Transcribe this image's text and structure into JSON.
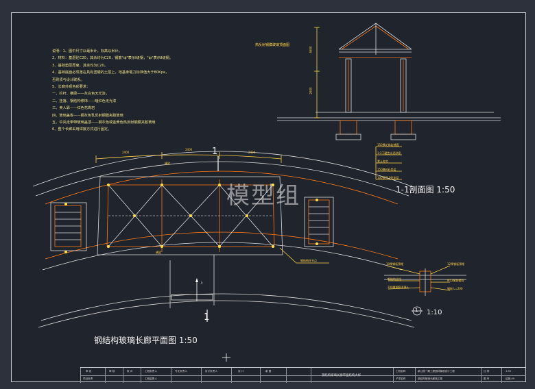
{
  "notes": {
    "lines": [
      "说明：1、图中尺寸以毫米计，标高以米计。",
      "2、材料：基层砼C20，其余均为C20，钢筋\"ф\"表示Ⅰ级钢，\"ф\"表示Ⅱ级钢。",
      "3、基础垫层厚度，其余均为C20。",
      "4、基础底面必须落在具有坚硬的土层上，地基承载力标准值大于80Kpa，",
      "   否则须与设计联系。",
      "5、长廊外观色彩要求：",
      "   一、栏杆、横梁——灰白色无光漆，",
      "   二、挂落、钢结构修饰——暗红色无光漆",
      "   三、美人靠——红色花岗岩",
      "   四、玻璃盖板——钢灰色乳反射钢膜夹胶玻璃",
      "   五、中央走带带玻璃盖顶——钢灰色或金黄色热反射钢膜夹胶玻璃",
      "6、整个长廊采用焊接方式进行固定。"
    ]
  },
  "plan": {
    "title": "钢结构玻璃长廊平面图   1:50",
    "section_mark_top": "1",
    "section_mark_bottom": "1",
    "arrow_label": "上",
    "label_top": "横梁",
    "label_bottom": "横梁",
    "label_right": "钢结构柱节点",
    "dim_1": "2400",
    "dim_2": "2400",
    "dim_3": "2400"
  },
  "section": {
    "header": "热反射钢膜玻璃顶面图",
    "title": "1-1剖面图   1:50",
    "dim_height": "4600",
    "dim_low": "2600",
    "legend": [
      "150厚花岗岩铺面",
      "1:3干硬性水泥砂浆",
      "素土夯实",
      "150厚碎石垫层",
      "100厚C10砼垫层"
    ]
  },
  "detail": {
    "title": "1:10",
    "circle_num": "1",
    "labels_left": [
      "10厚钢板预埋",
      "钢结构立柱",
      "200厚钢筋混凝土"
    ],
    "labels_right": [
      "12厚钢板预埋",
      "M12膨胀螺栓",
      "钢板 L=200"
    ]
  },
  "watermark": "模型组",
  "titleblock": {
    "row1": [
      "审 定",
      "审 核",
      "校 对",
      "工程负责人",
      "专业负责人",
      "设计负责人",
      "设 计",
      "制 图"
    ],
    "row2": [
      "项目负责",
      "",
      "",
      "工程监督人",
      "",
      "",
      "",
      ""
    ],
    "drawing_name": "钢结构玻璃长廊平面结构大样",
    "project_label": "工程名称",
    "project_name": "某公园一期工程园林景观设计工程",
    "sheet_label": "子项名称",
    "sheet_name": "钢结构玻璃长廊施工图",
    "scale_label": "比 例",
    "scale": "1:50",
    "no_label": "图 号",
    "no": "结施-09"
  }
}
